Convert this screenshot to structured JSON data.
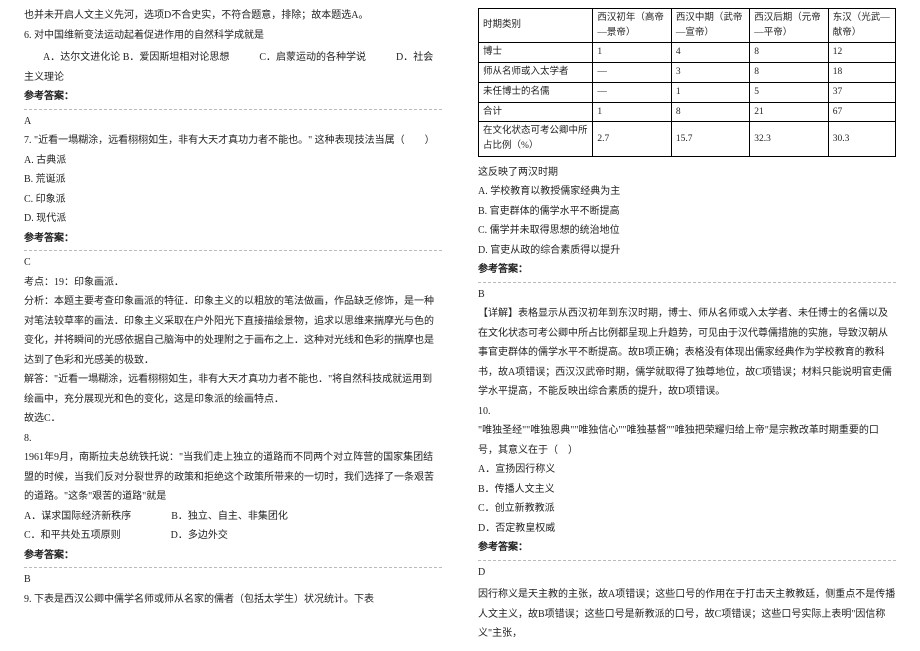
{
  "left": {
    "intro": "也并未开启人文主义先河，选项D不合史实，不符合题意，排除；故本题选A。",
    "q6_stem": "6. 对中国维新变法运动起着促进作用的自然科学成就是",
    "q6_opts": "A．达尔文进化论 B．爱因斯坦相对论思想　　　C．启蒙运动的各种学说　　　D．社会主义理论",
    "ans_label": "参考答案：",
    "q6_ans": "A",
    "q7_stem": "7. \"近看一塌糊涂，远看栩栩如生，非有大天才真功力者不能也。\" 这种表现技法当属（　　）",
    "q7_a": "A. 古典派",
    "q7_b": "B. 荒诞派",
    "q7_c": "C. 印象派",
    "q7_d": "D. 现代派",
    "q7_ans": "C",
    "kd": "考点：19：印象画派．",
    "fx1": "分析：本题主要考查印象画派的特征．印象主义的以粗放的笔法做画，作品缺乏修饰，是一种对笔法较草率的画法．印象主义采取在户外阳光下直接描绘景物，追求以思维来揣摩光与色的变化，并将瞬间的光感依据自己脑海中的处理附之于画布之上．这种对光线和色彩的揣摩也是达到了色彩和光感美的极致．",
    "fx2": "解答：\"近看一塌糊涂，远看栩栩如生，非有大天才真功力者不能也．\"将自然科技成就运用到绘画中，充分展现光和色的变化，这是印象派的绘画特点．",
    "fx3": "故选C．",
    "q8_num": "8.",
    "q8_1": "1961年9月，南斯拉夫总统铁托说：\"当我们走上独立的道路而不同两个对立阵营的国家集团结盟的时候，当我们反对分裂世界的政策和拒绝这个政策所带来的一切时，我们选择了一条艰苦的道路。\"这条\"艰苦的道路\"就是",
    "q8_row1": "A．谋求国际经济新秩序　　　　B．独立、自主、非集团化",
    "q8_row2": "C．和平共处五项原则　　　　　D．多边外交",
    "q8_ans": "B",
    "q9": "9. 下表是西汉公卿中儒学名师或师从名家的儒者（包括太学生）状况统计。下表"
  },
  "right": {
    "table": {
      "h0": "时期类别",
      "h1": "西汉初年（高帝—景帝）",
      "h2": "西汉中期（武帝—宣帝）",
      "h3": "西汉后期（元帝—平帝）",
      "h4": "东汉（光武—献帝）",
      "rows": [
        [
          "博士",
          "1",
          "4",
          "8",
          "12"
        ],
        [
          "师从名师或入太学者",
          "—",
          "3",
          "8",
          "18"
        ],
        [
          "未任博士的名儒",
          "—",
          "1",
          "5",
          "37"
        ],
        [
          "合计",
          "1",
          "8",
          "21",
          "67"
        ],
        [
          "在文化状态可考公卿中所占比例（%）",
          "2.7",
          "15.7",
          "32.3",
          "30.3"
        ]
      ]
    },
    "after_table": "这反映了两汉时期",
    "opt_a": "A. 学校教育以教授儒家经典为主",
    "opt_b": "B. 官吏群体的儒学水平不断提高",
    "opt_c": "C. 儒学并未取得思想的统治地位",
    "opt_d": "D. 官吏从政的综合素质得以提升",
    "ans_label": "参考答案：",
    "q9_ans": "B",
    "xj": "【详解】表格显示从西汉初年到东汉时期，博士、师从名师或入太学者、未任博士的名儒以及在文化状态可考公卿中所占比例都呈现上升趋势，可见由于汉代尊儒措施的实施，导致汉朝从事官吏群体的儒学水平不断提高。故B项正确；表格没有体现出儒家经典作为学校教育的教科书，故A项错误；西汉汉武帝时期，儒学就取得了独尊地位，故C项错误；材料只能说明官吏儒学水平提高，不能反映出综合素质的提升，故D项错误。",
    "q10_num": "10.",
    "q10_stem": "\"唯独圣经\"\"唯独恩典\"\"唯独信心\"\"唯独基督\"\"唯独把荣耀归给上帝\"是宗教改革时期重要的口号，其意义在于（　）",
    "q10_a": "A．宣扬因行称义",
    "q10_b": "B．传播人文主义",
    "q10_c": "C．创立新教教派",
    "q10_d": "D．否定教皇权威",
    "q10_ans": "D",
    "q10_exp": "因行称义是天主教的主张，故A项错误；这些口号的作用在于打击天主教教廷，侧重点不是传播人文主义，故B项错误；这些口号是新教派的口号，故C项错误；这些口号实际上表明\"因信称义\"主张，"
  }
}
